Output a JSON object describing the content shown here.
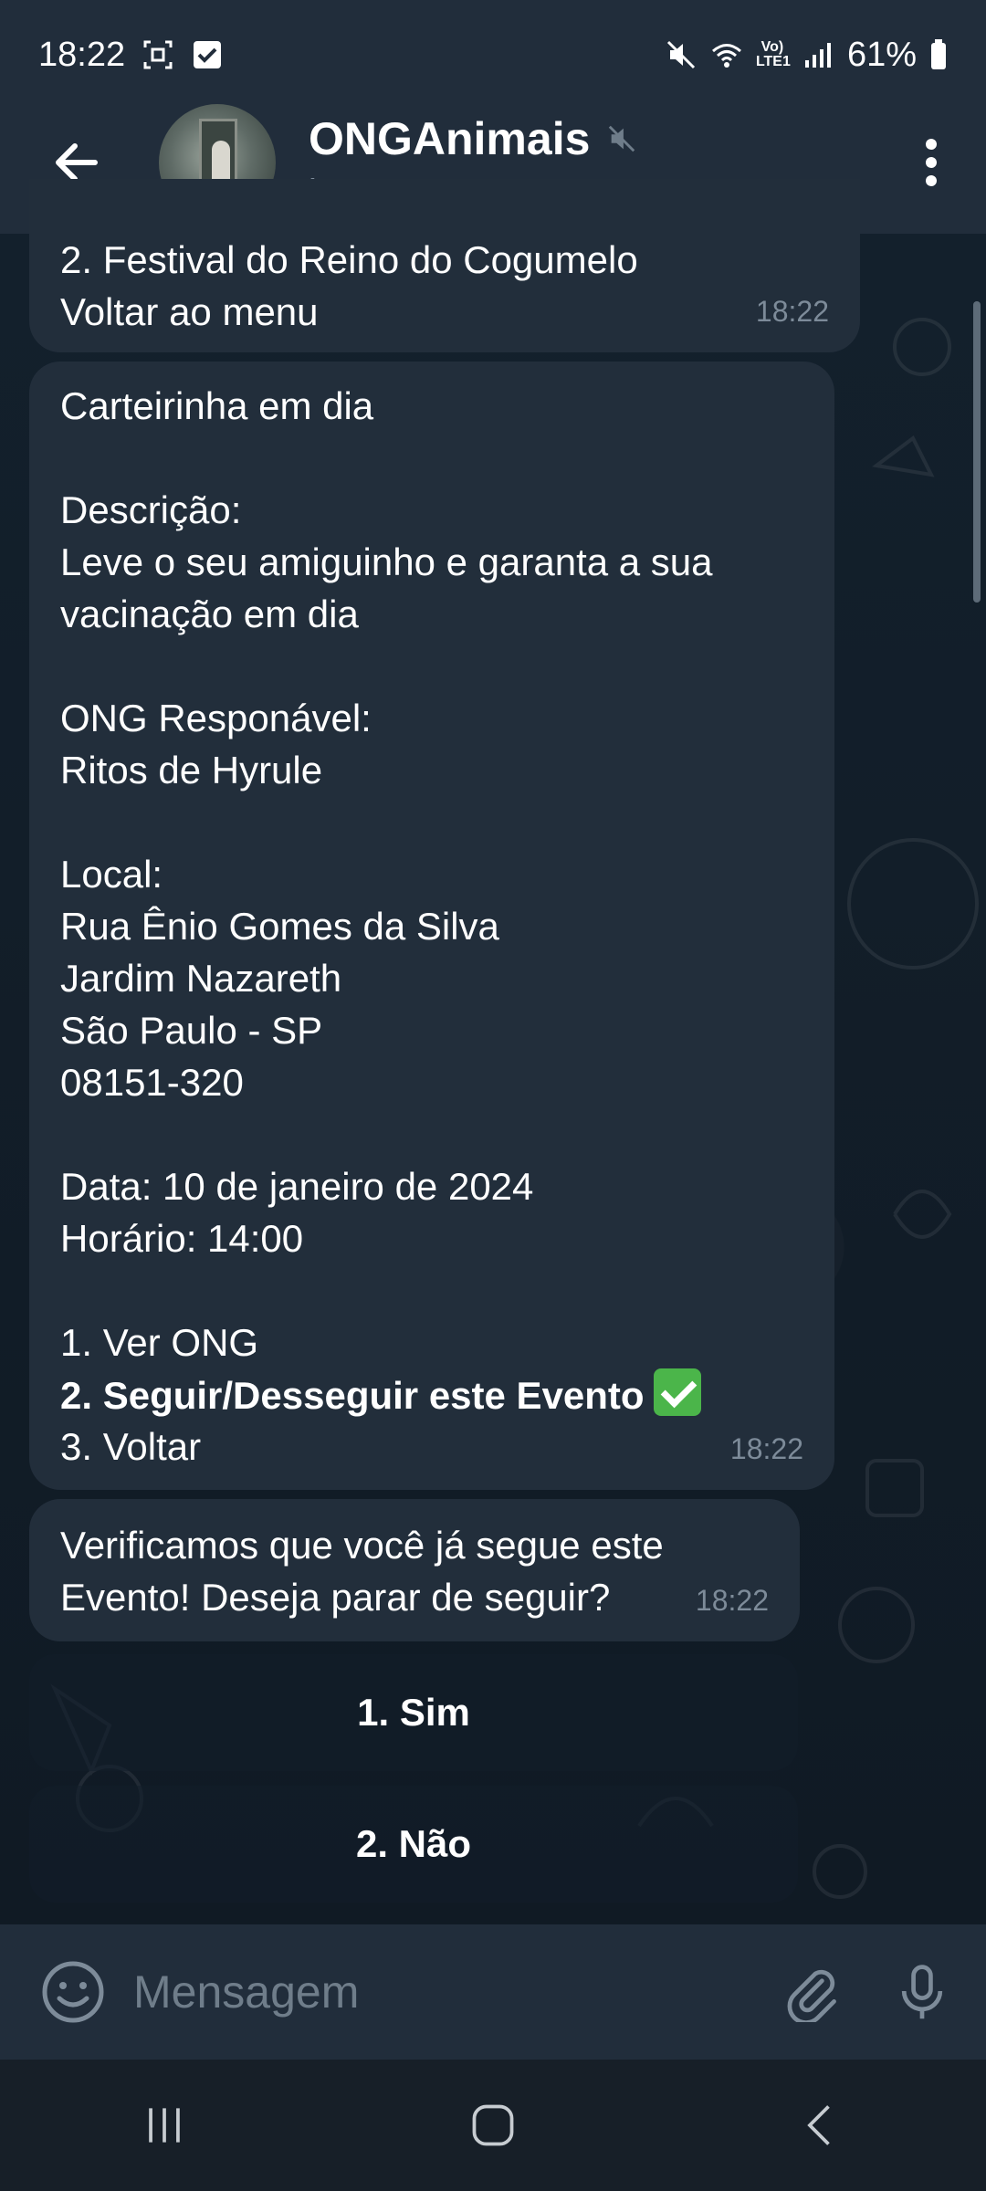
{
  "status_bar": {
    "time": "18:22",
    "battery": "61%",
    "network_label": "Vo) LTE1"
  },
  "header": {
    "title": "ONGAnimais",
    "subtitle": "bot"
  },
  "messages": [
    {
      "lines": [
        "2. Festival do Reino do Cogumelo",
        "Voltar ao menu"
      ],
      "time": "18:22"
    },
    {
      "lines": [
        "Carteirinha em dia",
        "",
        "Descrição:",
        "Leve o seu amiguinho e garanta a sua",
        "vacinação em dia",
        "",
        "ONG Responável:",
        "Ritos de Hyrule",
        "",
        "Local:",
        "Rua Ênio Gomes da Silva",
        "Jardim Nazareth",
        "São Paulo - SP",
        "08151-320",
        "",
        "Data: 10 de janeiro de 2024",
        "Horário: 14:00",
        "",
        "1. Ver ONG",
        "2. Seguir/Desseguir este Evento",
        "3. Voltar"
      ],
      "time": "18:22"
    },
    {
      "lines": [
        "Verificamos que você já segue este",
        "Evento! Deseja parar de seguir?"
      ],
      "time": "18:22"
    }
  ],
  "keyboard": {
    "buttons": [
      "1. Sim",
      "2. Não"
    ]
  },
  "input": {
    "placeholder": "Mensagem"
  },
  "colors": {
    "bubble": "#222e3b",
    "header": "#212d3b",
    "accent_check": "#4bb54a",
    "muted_text": "#7d8b99"
  },
  "icons": {
    "back": "arrow-left-icon",
    "mute": "speaker-muted-icon",
    "menu": "more-vertical-icon",
    "emoji": "smile-icon",
    "attach": "paperclip-icon",
    "mic": "microphone-icon",
    "check": "check-mark-button-emoji"
  }
}
